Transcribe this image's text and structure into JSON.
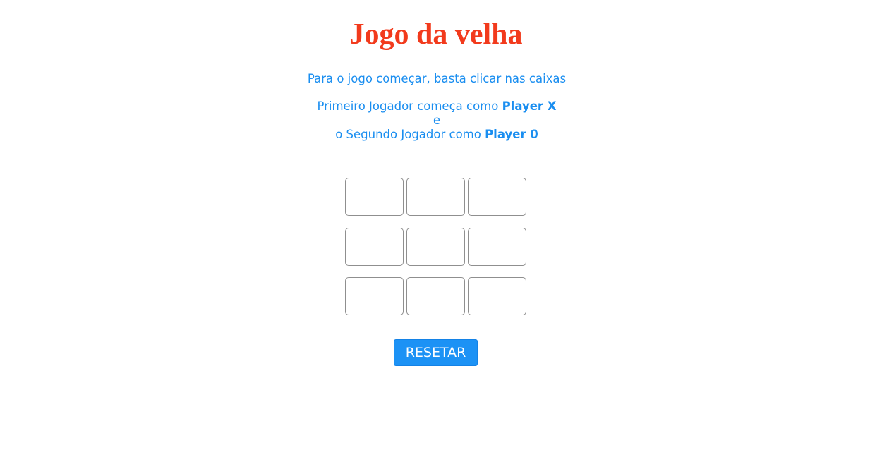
{
  "title": "Jogo da velha",
  "instructions": {
    "line1": "Para o jogo começar, basta clicar nas caixas",
    "first_prefix": "Primeiro Jogador começa como ",
    "first_player": "Player X",
    "connector": "e",
    "second_prefix": "o Segundo Jogador como ",
    "second_player": "Player 0"
  },
  "board": {
    "cells": [
      "",
      "",
      "",
      "",
      "",
      "",
      "",
      "",
      ""
    ]
  },
  "reset_label": "RESETAR",
  "colors": {
    "title": "#f23a1c",
    "text": "#1a8ef0",
    "button": "#1c92f5"
  }
}
